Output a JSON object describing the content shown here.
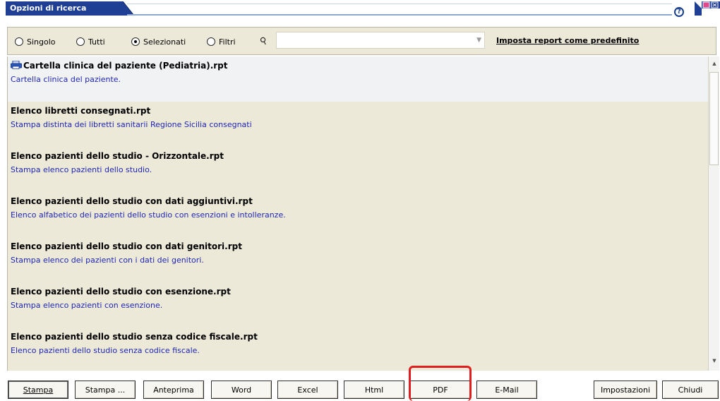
{
  "window": {
    "title": "Opzioni di ricerca"
  },
  "title_controls": {
    "help_glyph": "?"
  },
  "filters": {
    "radios": [
      {
        "label": "Singolo",
        "checked": false
      },
      {
        "label": "Tutti",
        "checked": false
      },
      {
        "label": "Selezionati",
        "checked": true
      },
      {
        "label": "Filtri",
        "checked": false
      }
    ],
    "combo_value": "",
    "set_default_link": "Imposta report come predefinito"
  },
  "reports": [
    {
      "title": "Cartella clinica del paziente (Pediatria).rpt",
      "description": "Cartella clinica del paziente.",
      "selected": true,
      "icon": "printer-icon"
    },
    {
      "title": "Elenco libretti consegnati.rpt",
      "description": "Stampa distinta dei libretti sanitarii Regione Sicilia consegnati",
      "selected": false
    },
    {
      "title": "Elenco pazienti dello studio - Orizzontale.rpt",
      "description": "Stampa elenco pazienti dello studio.",
      "selected": false
    },
    {
      "title": "Elenco pazienti dello studio con dati aggiuntivi.rpt",
      "description": "Elenco alfabetico dei pazienti dello studio con esenzioni e intolleranze.",
      "selected": false
    },
    {
      "title": "Elenco pazienti dello studio con dati genitori.rpt",
      "description": "Stampa elenco dei pazienti con i dati dei genitori.",
      "selected": false
    },
    {
      "title": "Elenco pazienti dello studio con esenzione.rpt",
      "description": "Stampa elenco pazienti con esenzione.",
      "selected": false
    },
    {
      "title": "Elenco pazienti dello studio senza codice fiscale.rpt",
      "description": "Elenco pazienti dello studio senza codice fiscale.",
      "selected": false
    }
  ],
  "buttons": {
    "stampa": "Stampa",
    "stampa_dots": "Stampa ...",
    "anteprima": "Anteprima",
    "word": "Word",
    "excel": "Excel",
    "html": "Html",
    "pdf": "PDF",
    "email": "E-Mail",
    "impostazioni": "Impostazioni",
    "chiudi": "Chiudi"
  },
  "colors": {
    "title_tab": "#1f3f95",
    "description_text": "#1f27b0",
    "list_background": "#ece9d8",
    "highlight": "#e01e1e"
  }
}
